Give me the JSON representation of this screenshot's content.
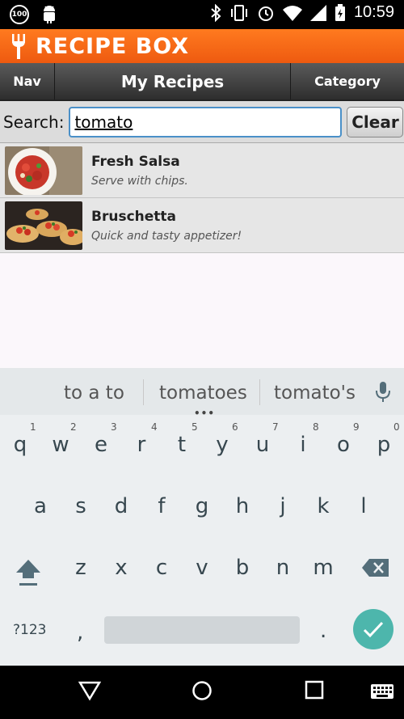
{
  "status_bar": {
    "badge": "100",
    "time": "10:59"
  },
  "app": {
    "title": "RECIPE BOX"
  },
  "nav": {
    "nav_label": "Nav",
    "title": "My Recipes",
    "category_label": "Category"
  },
  "search": {
    "label": "Search:",
    "value": "tomato",
    "clear_label": "Clear"
  },
  "recipes": [
    {
      "name": "Fresh Salsa",
      "description": "Serve with chips."
    },
    {
      "name": "Bruschetta",
      "description": "Quick and tasty appetizer!"
    }
  ],
  "keyboard": {
    "suggestions": [
      "to a to",
      "tomatoes",
      "tomato's"
    ],
    "row1": [
      "q",
      "w",
      "e",
      "r",
      "t",
      "y",
      "u",
      "i",
      "o",
      "p"
    ],
    "row1_numbers": [
      "1",
      "2",
      "3",
      "4",
      "5",
      "6",
      "7",
      "8",
      "9",
      "0"
    ],
    "row2": [
      "a",
      "s",
      "d",
      "f",
      "g",
      "h",
      "j",
      "k",
      "l"
    ],
    "row3": [
      "z",
      "x",
      "c",
      "v",
      "b",
      "n",
      "m"
    ],
    "symbols_label": "?123",
    "comma": ",",
    "period": "."
  },
  "colors": {
    "title_bar": "#ee5a10",
    "enter_key": "#4db6ac",
    "search_border": "#4a90c8"
  }
}
